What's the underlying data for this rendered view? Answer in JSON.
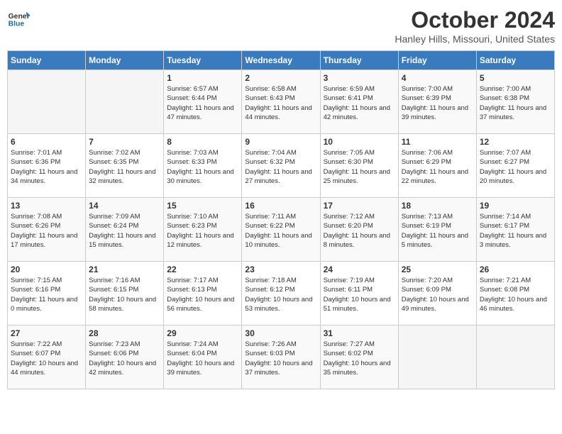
{
  "header": {
    "logo_line1": "General",
    "logo_line2": "Blue",
    "title": "October 2024",
    "subtitle": "Hanley Hills, Missouri, United States"
  },
  "weekdays": [
    "Sunday",
    "Monday",
    "Tuesday",
    "Wednesday",
    "Thursday",
    "Friday",
    "Saturday"
  ],
  "weeks": [
    [
      {
        "day": "",
        "info": ""
      },
      {
        "day": "",
        "info": ""
      },
      {
        "day": "1",
        "info": "Sunrise: 6:57 AM\nSunset: 6:44 PM\nDaylight: 11 hours and 47 minutes."
      },
      {
        "day": "2",
        "info": "Sunrise: 6:58 AM\nSunset: 6:43 PM\nDaylight: 11 hours and 44 minutes."
      },
      {
        "day": "3",
        "info": "Sunrise: 6:59 AM\nSunset: 6:41 PM\nDaylight: 11 hours and 42 minutes."
      },
      {
        "day": "4",
        "info": "Sunrise: 7:00 AM\nSunset: 6:39 PM\nDaylight: 11 hours and 39 minutes."
      },
      {
        "day": "5",
        "info": "Sunrise: 7:00 AM\nSunset: 6:38 PM\nDaylight: 11 hours and 37 minutes."
      }
    ],
    [
      {
        "day": "6",
        "info": "Sunrise: 7:01 AM\nSunset: 6:36 PM\nDaylight: 11 hours and 34 minutes."
      },
      {
        "day": "7",
        "info": "Sunrise: 7:02 AM\nSunset: 6:35 PM\nDaylight: 11 hours and 32 minutes."
      },
      {
        "day": "8",
        "info": "Sunrise: 7:03 AM\nSunset: 6:33 PM\nDaylight: 11 hours and 30 minutes."
      },
      {
        "day": "9",
        "info": "Sunrise: 7:04 AM\nSunset: 6:32 PM\nDaylight: 11 hours and 27 minutes."
      },
      {
        "day": "10",
        "info": "Sunrise: 7:05 AM\nSunset: 6:30 PM\nDaylight: 11 hours and 25 minutes."
      },
      {
        "day": "11",
        "info": "Sunrise: 7:06 AM\nSunset: 6:29 PM\nDaylight: 11 hours and 22 minutes."
      },
      {
        "day": "12",
        "info": "Sunrise: 7:07 AM\nSunset: 6:27 PM\nDaylight: 11 hours and 20 minutes."
      }
    ],
    [
      {
        "day": "13",
        "info": "Sunrise: 7:08 AM\nSunset: 6:26 PM\nDaylight: 11 hours and 17 minutes."
      },
      {
        "day": "14",
        "info": "Sunrise: 7:09 AM\nSunset: 6:24 PM\nDaylight: 11 hours and 15 minutes."
      },
      {
        "day": "15",
        "info": "Sunrise: 7:10 AM\nSunset: 6:23 PM\nDaylight: 11 hours and 12 minutes."
      },
      {
        "day": "16",
        "info": "Sunrise: 7:11 AM\nSunset: 6:22 PM\nDaylight: 11 hours and 10 minutes."
      },
      {
        "day": "17",
        "info": "Sunrise: 7:12 AM\nSunset: 6:20 PM\nDaylight: 11 hours and 8 minutes."
      },
      {
        "day": "18",
        "info": "Sunrise: 7:13 AM\nSunset: 6:19 PM\nDaylight: 11 hours and 5 minutes."
      },
      {
        "day": "19",
        "info": "Sunrise: 7:14 AM\nSunset: 6:17 PM\nDaylight: 11 hours and 3 minutes."
      }
    ],
    [
      {
        "day": "20",
        "info": "Sunrise: 7:15 AM\nSunset: 6:16 PM\nDaylight: 11 hours and 0 minutes."
      },
      {
        "day": "21",
        "info": "Sunrise: 7:16 AM\nSunset: 6:15 PM\nDaylight: 10 hours and 58 minutes."
      },
      {
        "day": "22",
        "info": "Sunrise: 7:17 AM\nSunset: 6:13 PM\nDaylight: 10 hours and 56 minutes."
      },
      {
        "day": "23",
        "info": "Sunrise: 7:18 AM\nSunset: 6:12 PM\nDaylight: 10 hours and 53 minutes."
      },
      {
        "day": "24",
        "info": "Sunrise: 7:19 AM\nSunset: 6:11 PM\nDaylight: 10 hours and 51 minutes."
      },
      {
        "day": "25",
        "info": "Sunrise: 7:20 AM\nSunset: 6:09 PM\nDaylight: 10 hours and 49 minutes."
      },
      {
        "day": "26",
        "info": "Sunrise: 7:21 AM\nSunset: 6:08 PM\nDaylight: 10 hours and 46 minutes."
      }
    ],
    [
      {
        "day": "27",
        "info": "Sunrise: 7:22 AM\nSunset: 6:07 PM\nDaylight: 10 hours and 44 minutes."
      },
      {
        "day": "28",
        "info": "Sunrise: 7:23 AM\nSunset: 6:06 PM\nDaylight: 10 hours and 42 minutes."
      },
      {
        "day": "29",
        "info": "Sunrise: 7:24 AM\nSunset: 6:04 PM\nDaylight: 10 hours and 39 minutes."
      },
      {
        "day": "30",
        "info": "Sunrise: 7:26 AM\nSunset: 6:03 PM\nDaylight: 10 hours and 37 minutes."
      },
      {
        "day": "31",
        "info": "Sunrise: 7:27 AM\nSunset: 6:02 PM\nDaylight: 10 hours and 35 minutes."
      },
      {
        "day": "",
        "info": ""
      },
      {
        "day": "",
        "info": ""
      }
    ]
  ]
}
